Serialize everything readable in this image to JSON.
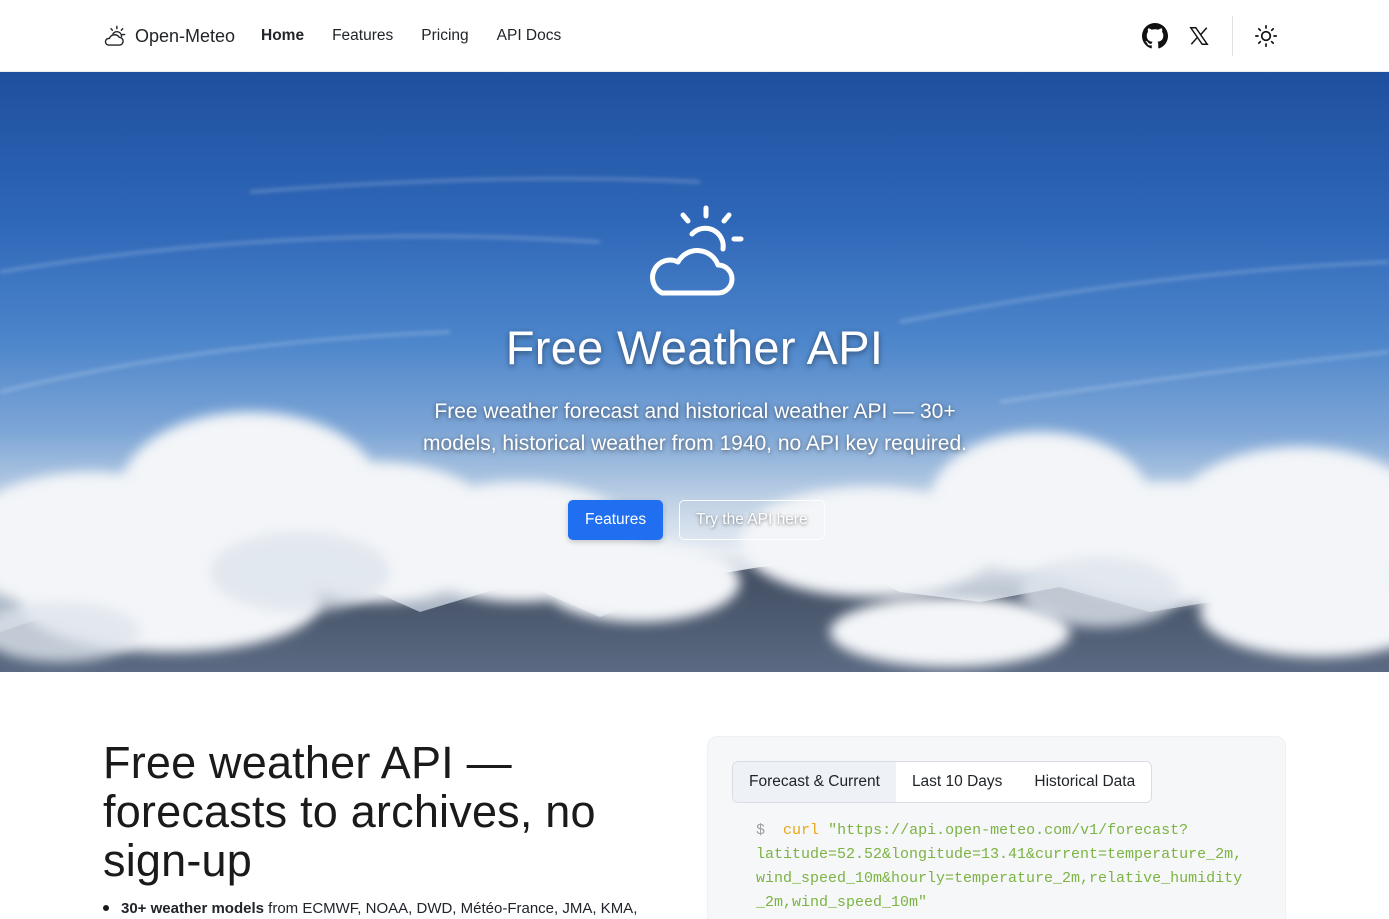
{
  "nav": {
    "brand": "Open-Meteo",
    "links": [
      "Home",
      "Features",
      "Pricing",
      "API Docs"
    ],
    "icons": [
      "github-icon",
      "x-twitter-icon",
      "sun-theme-icon"
    ]
  },
  "hero": {
    "title": "Free Weather API",
    "subtitle": "Free weather forecast and historical weather API — 30+ models, historical weather from 1940, no API key required.",
    "primary_button": "Features",
    "secondary_button": "Try the API here"
  },
  "section": {
    "title": "Free weather API — forecasts to archives, no sign-up",
    "features": [
      {
        "bold": "30+ weather models",
        "text": " from ECMWF, NOAA, DWD, Météo-France, JMA, KMA,"
      }
    ]
  },
  "code_card": {
    "tabs": [
      "Forecast & Current",
      "Last 10 Days",
      "Historical Data"
    ],
    "active_tab": 0,
    "prompt": "$",
    "command": "curl",
    "lines": [
      "\"https://api.open-meteo.com/v1/forecast?",
      "latitude=52.52&longitude=13.41&current=temperature_2m,",
      "wind_speed_10m&hourly=temperature_2m,relative_humidity",
      "_2m,wind_speed_10m\""
    ]
  },
  "colors": {
    "primary": "#1f6ff0",
    "code_green": "#7cb342",
    "code_orange": "#e6a817"
  }
}
